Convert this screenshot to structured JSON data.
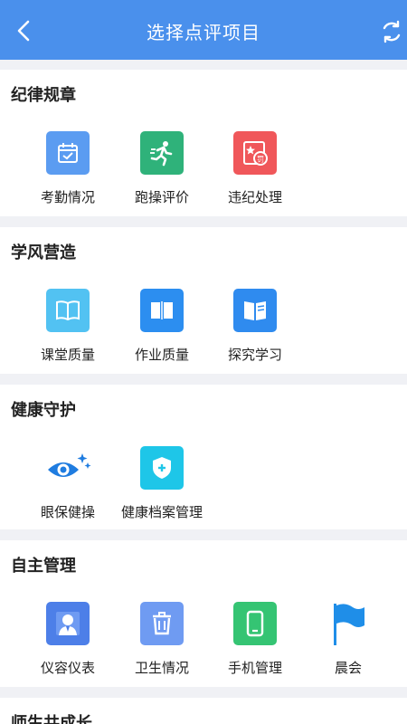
{
  "header": {
    "title": "选择点评项目",
    "back_icon": "chevron-left-icon",
    "refresh_icon": "refresh-icon",
    "bg_color": "#4a90ec"
  },
  "sections": [
    {
      "title": "纪律规章",
      "items": [
        {
          "label": "考勤情况",
          "icon": "calendar-check-icon",
          "color": "#5b9cf1"
        },
        {
          "label": "跑操评价",
          "icon": "running-icon",
          "color": "#2fb27a"
        },
        {
          "label": "违纪处理",
          "icon": "penalty-icon",
          "color": "#f0575a"
        }
      ]
    },
    {
      "title": "学风营造",
      "items": [
        {
          "label": "课堂质量",
          "icon": "open-book-icon",
          "color": "#52c2f2"
        },
        {
          "label": "作业质量",
          "icon": "notebook-icon",
          "color": "#2c8ef0"
        },
        {
          "label": "探究学习",
          "icon": "book-icon",
          "color": "#2f8bef"
        }
      ]
    },
    {
      "title": "健康守护",
      "items": [
        {
          "label": "眼保健操",
          "icon": "eye-sparkle-icon",
          "color": "#1f7ce0"
        },
        {
          "label": "健康档案管理",
          "icon": "shield-plus-icon",
          "color": "#1ec6e8"
        }
      ]
    },
    {
      "title": "自主管理",
      "items": [
        {
          "label": "仪容仪表",
          "icon": "person-icon",
          "color": "#4d7fe8"
        },
        {
          "label": "卫生情况",
          "icon": "trash-icon",
          "color": "#6f9bf2"
        },
        {
          "label": "手机管理",
          "icon": "phone-icon",
          "color": "#35c473"
        },
        {
          "label": "晨会",
          "icon": "flag-icon",
          "color": "#1f8ee8"
        }
      ]
    },
    {
      "title": "师生共成长",
      "items": []
    }
  ]
}
